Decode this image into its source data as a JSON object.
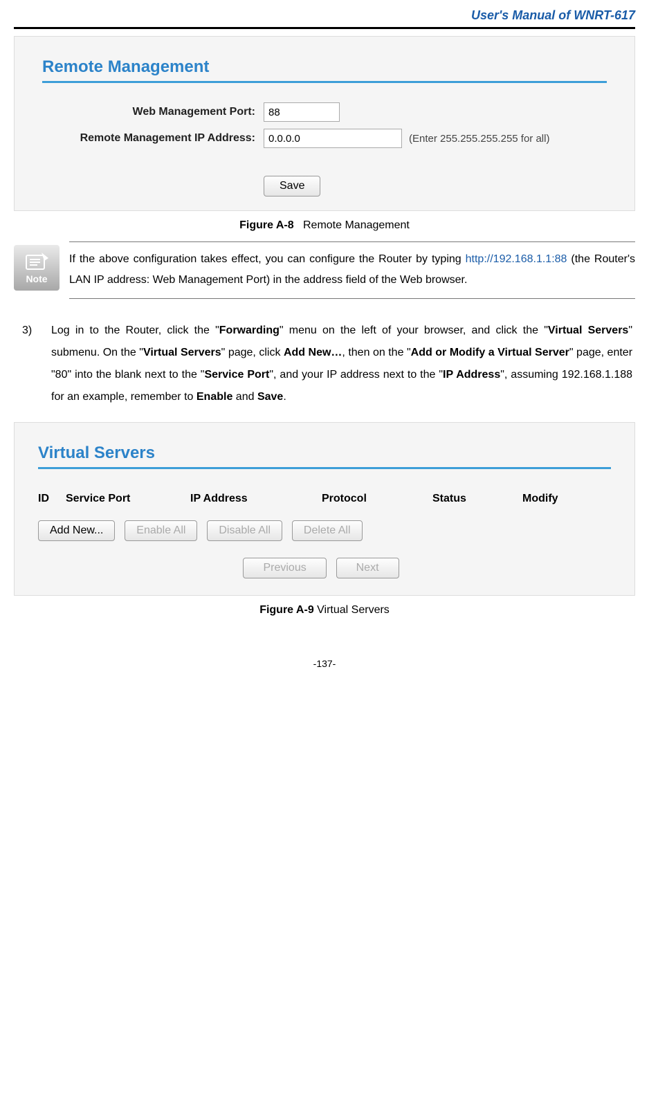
{
  "header": {
    "title": "User's Manual of WNRT-617"
  },
  "panel1": {
    "heading": "Remote Management",
    "fields": {
      "port_label": "Web Management Port:",
      "port_value": "88",
      "ip_label": "Remote Management IP Address:",
      "ip_value": "0.0.0.0",
      "ip_hint": "(Enter 255.255.255.255 for all)"
    },
    "save_label": "Save"
  },
  "figureA8": {
    "label": "Figure A-8",
    "title": "Remote Management"
  },
  "note": {
    "icon_label": "Note",
    "before_link": "If the above configuration takes effect, you can configure the Router by typing ",
    "link": "http://192.168.1.1:88",
    "after_link": " (the Router's LAN IP address: Web Management Port) in the address field of the Web browser."
  },
  "step3": {
    "num": "3)",
    "t1": "Log in to the Router, click the \"",
    "b1": "Forwarding",
    "t2": "\" menu on the left of your browser, and click the \"",
    "b2": "Virtual Servers",
    "t3": "\" submenu. On the \"",
    "b3": "Virtual Servers",
    "t4": "\" page, click ",
    "b4": "Add New…",
    "t5": ", then on the \"",
    "b5": "Add or Modify a Virtual Server",
    "t6": "\" page, enter \"80\" into the blank next to the \"",
    "b6": "Service Port",
    "t7": "\", and your IP address next to the \"",
    "b7": "IP Address",
    "t8": "\", assuming 192.168.1.188 for an example, remember to ",
    "b8": "Enable",
    "t9": " and ",
    "b9": "Save",
    "t10": "."
  },
  "panel2": {
    "heading": "Virtual Servers",
    "columns": {
      "id": "ID",
      "service_port": "Service Port",
      "ip_address": "IP Address",
      "protocol": "Protocol",
      "status": "Status",
      "modify": "Modify"
    },
    "buttons": {
      "add_new": "Add New...",
      "enable_all": "Enable All",
      "disable_all": "Disable All",
      "delete_all": "Delete All",
      "previous": "Previous",
      "next": "Next"
    }
  },
  "figureA9": {
    "label": "Figure A-9",
    "title": " Virtual Servers"
  },
  "page_number": "-137-"
}
